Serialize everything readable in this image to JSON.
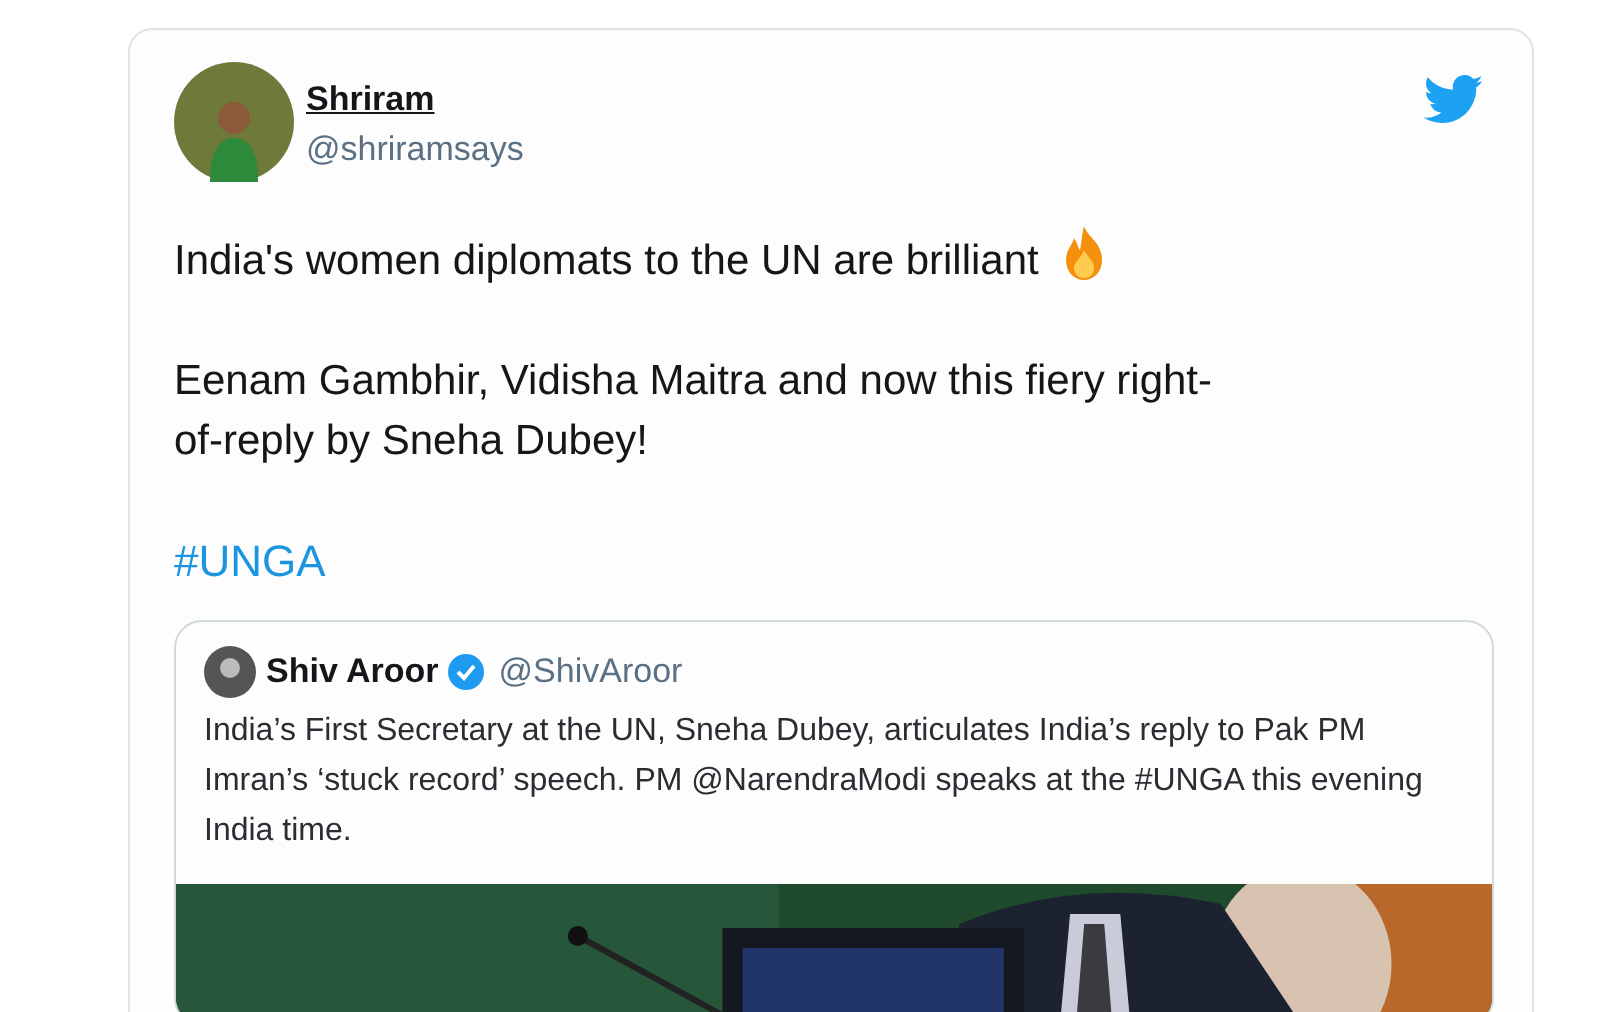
{
  "tweet": {
    "author": {
      "name": "Shriram",
      "handle": "@shriramsays"
    },
    "paragraphs": [
      {
        "kind": "text",
        "text": "India's women diplomats to the UN are brilliant",
        "fire_icon": true
      },
      {
        "kind": "text",
        "text": "Eenam Gambhir, Vidisha Maitra and now this fiery right-of-reply by Sneha Dubey!"
      },
      {
        "kind": "hashtag",
        "text": "#UNGA"
      }
    ],
    "quoted": {
      "name": "Shiv Aroor",
      "verified": true,
      "handle": "@ShivAroor",
      "text": "India’s First Secretary at the UN, Sneha Dubey, articulates India’s reply to Pak PM Imran’s ‘stuck record’ speech. PM @NarendraModi speaks at the #UNGA this evening India time."
    }
  }
}
